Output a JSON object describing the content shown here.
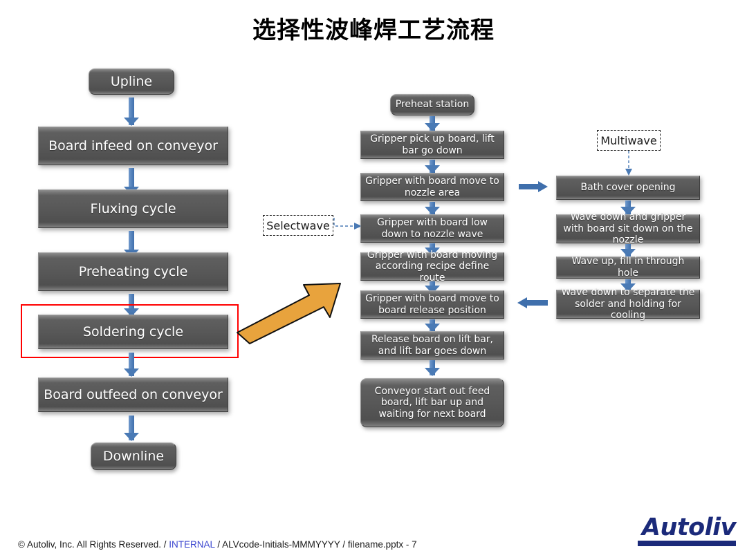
{
  "slide": {
    "title": "选择性波峰焊工艺流程"
  },
  "colors": {
    "box_fill": "#585858",
    "box_text": "#ffffff",
    "arrow_blue": "#3f6fac",
    "highlight_red": "#ff0000",
    "orange_arrow": "#e8a33d",
    "logo_blue": "#1b2a7a",
    "internal_blue": "#3b46cf"
  },
  "left_flow": {
    "steps": [
      {
        "label": "Upline",
        "shape": "rounded"
      },
      {
        "label": "Board infeed on conveyor",
        "shape": "rect"
      },
      {
        "label": "Fluxing cycle",
        "shape": "rect"
      },
      {
        "label": "Preheating cycle",
        "shape": "rect"
      },
      {
        "label": "Soldering cycle",
        "shape": "rect"
      },
      {
        "label": "Board outfeed on conveyor",
        "shape": "rect"
      },
      {
        "label": "Downline",
        "shape": "rounded"
      }
    ],
    "highlighted_step": "Soldering cycle"
  },
  "middle_flow": {
    "steps": [
      {
        "label": "Preheat station",
        "shape": "rounded"
      },
      {
        "label": "Gripper pick up board, lift bar go down",
        "shape": "rect"
      },
      {
        "label": "Gripper with board move to nozzle area",
        "shape": "rect"
      },
      {
        "label": "Gripper with board low down to nozzle wave",
        "shape": "rect"
      },
      {
        "label": "Gripper with board moving according recipe define route",
        "shape": "rect"
      },
      {
        "label": "Gripper with board move to board release position",
        "shape": "rect"
      },
      {
        "label": "Release board on lift bar, and lift bar goes down",
        "shape": "rect"
      },
      {
        "label": "Conveyor start out feed board, lift bar up and waiting for next board",
        "shape": "rounded"
      }
    ]
  },
  "right_flow": {
    "steps": [
      {
        "label": "Bath cover opening",
        "shape": "rect"
      },
      {
        "label": "Wave down and gripper with board sit down on the nozzle",
        "shape": "rect"
      },
      {
        "label": "Wave up, fill in through hole",
        "shape": "rect"
      },
      {
        "label": "Wave down to separate the solder and holding for cooling",
        "shape": "rect"
      }
    ]
  },
  "callouts": {
    "selectwave": "Selectwave",
    "multiwave": "Multiwave"
  },
  "footer": {
    "prefix": "© Autoliv, Inc. All Rights Reserved. / ",
    "internal": "INTERNAL",
    "suffix": " / ALVcode-Initials-MMMYYYY / filename.pptx - 7",
    "logo_text": "Autoliv"
  }
}
